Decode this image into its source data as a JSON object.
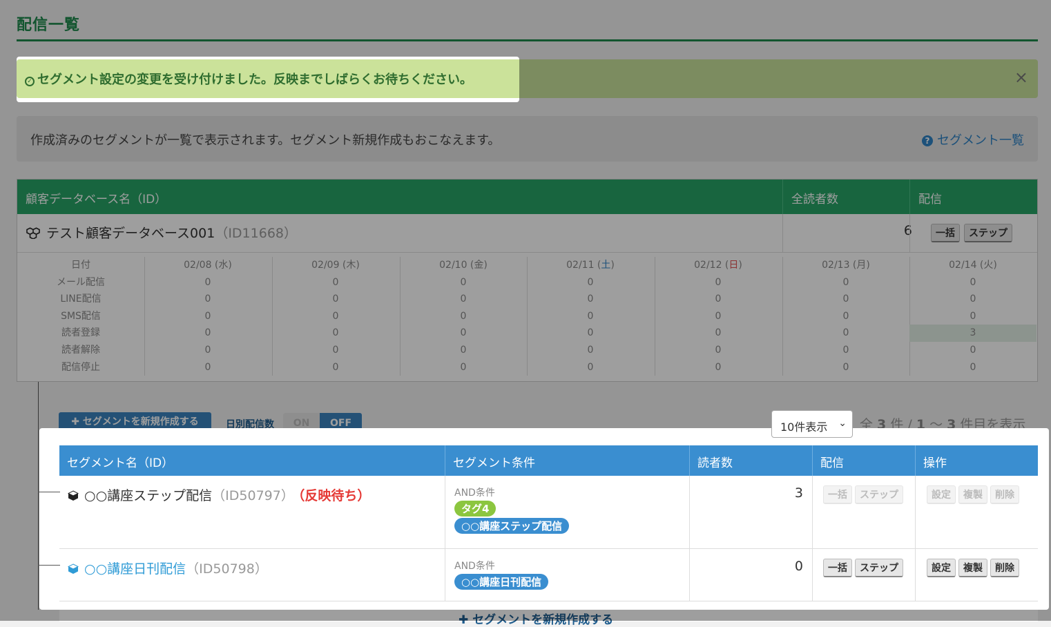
{
  "page": {
    "title": "配信一覧"
  },
  "alert": {
    "icon": "check-circle-icon",
    "message": "セグメント設定の変更を受け付けました。反映までしばらくお待ちください。",
    "close": "×"
  },
  "info": {
    "text": "作成済みのセグメントが一覧で表示されます。セグメント新規作成もおこなえます。",
    "help_link": "セグメント一覧",
    "help_icon": "question-circle-icon"
  },
  "database_table": {
    "headers": {
      "name": "顧客データベース名（ID）",
      "readers": "全読者数",
      "distribution": "配信"
    },
    "row": {
      "name": "テスト顧客データベース001",
      "id": "（ID11668）",
      "readers": "6",
      "btn_bulk": "一括",
      "btn_step": "ステップ",
      "icon": "cubes-icon"
    },
    "stats": {
      "row_labels": [
        "日付",
        "メール配信",
        "LINE配信",
        "SMS配信",
        "読者登録",
        "読者解除",
        "配信停止"
      ],
      "columns": [
        {
          "date": "02/08 (水)",
          "values": [
            "0",
            "0",
            "0",
            "0",
            "0",
            "0"
          ]
        },
        {
          "date": "02/09 (木)",
          "values": [
            "0",
            "0",
            "0",
            "0",
            "0",
            "0"
          ]
        },
        {
          "date": "02/10 (金)",
          "values": [
            "0",
            "0",
            "0",
            "0",
            "0",
            "0"
          ]
        },
        {
          "date_prefix": "02/11 (",
          "date_day": "土",
          "date_suffix": ")",
          "values": [
            "0",
            "0",
            "0",
            "0",
            "0",
            "0"
          ]
        },
        {
          "date_prefix": "02/12 (",
          "date_day": "日",
          "date_suffix": ")",
          "values": [
            "0",
            "0",
            "0",
            "0",
            "0",
            "0"
          ]
        },
        {
          "date": "02/13 (月)",
          "values": [
            "0",
            "0",
            "0",
            "0",
            "0",
            "0"
          ]
        },
        {
          "date": "02/14 (火)",
          "values": [
            "0",
            "0",
            "0",
            "3",
            "0",
            "0"
          ]
        }
      ]
    }
  },
  "segment_controls": {
    "new_button": "✚ セグメントを新規作成する",
    "daily_label": "日別配信数",
    "toggle_on": "ON",
    "toggle_off": "OFF",
    "per_page": "10件表示",
    "paging_prefix": "全 ",
    "paging_total": "3",
    "paging_mid": " 件 / ",
    "paging_from": "1",
    "paging_tilde": " ～ ",
    "paging_to": "3",
    "paging_suffix": " 件目を表示"
  },
  "segment_table": {
    "headers": {
      "name": "セグメント名（ID）",
      "condition": "セグメント条件",
      "readers": "読者数",
      "distribution": "配信",
      "operations": "操作"
    },
    "rows": [
      {
        "name": "○○講座ステップ配信",
        "id": "（ID50797）",
        "status": "（反映待ち）",
        "cond_label": "AND条件",
        "tags": [
          "タグ4",
          "○○講座ステップ配信"
        ],
        "readers": "3",
        "btn_bulk": "一括",
        "btn_step": "ステップ",
        "btn_settings": "設定",
        "btn_copy": "複製",
        "btn_delete": "削除"
      },
      {
        "name": "○○講座日刊配信",
        "id": "（ID50798）",
        "cond_label": "AND条件",
        "tags": [
          "○○講座日刊配信"
        ],
        "readers": "0",
        "btn_bulk": "一括",
        "btn_step": "ステップ",
        "btn_settings": "設定",
        "btn_copy": "複製",
        "btn_delete": "削除"
      }
    ],
    "bottom_link": "✚ セグメントを新規作成する"
  },
  "colors": {
    "brand_green": "#27a467",
    "brand_blue": "#3a8ed0",
    "alert_bg": "#c8e29b",
    "pending_red": "#e53935",
    "tag_green": "#8cc63f"
  }
}
